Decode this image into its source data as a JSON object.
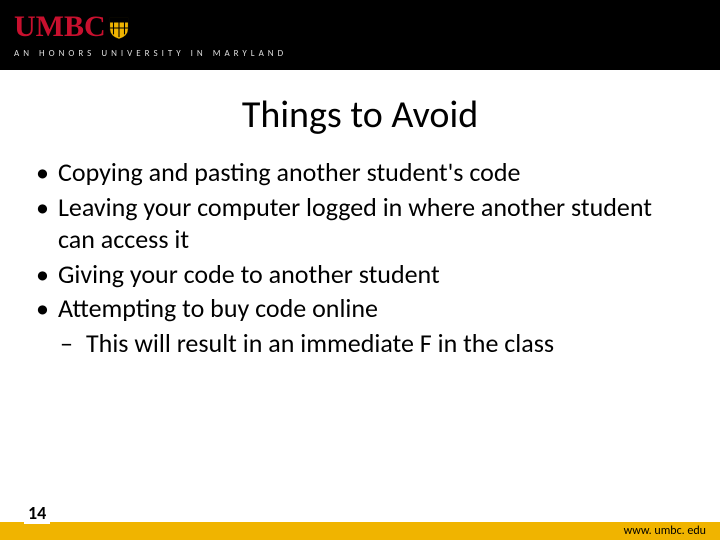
{
  "header": {
    "logo_text": "UMBC",
    "tagline": "AN  HONORS  UNIVERSITY  IN  MARYLAND"
  },
  "title": "Things to Avoid",
  "bullets": [
    {
      "text": "Copying and pasting another student's code"
    },
    {
      "text": "Leaving your computer logged in where another student can access it"
    },
    {
      "text": "Giving your code to another student"
    },
    {
      "text": "Attempting to buy code online",
      "sub": [
        {
          "text": "This will result in an immediate F in the class"
        }
      ]
    }
  ],
  "footer": {
    "page_number": "14",
    "url": "www. umbc. edu"
  },
  "colors": {
    "brand_red": "#c8102e",
    "brand_gold": "#f0b400",
    "header_black": "#000000"
  }
}
